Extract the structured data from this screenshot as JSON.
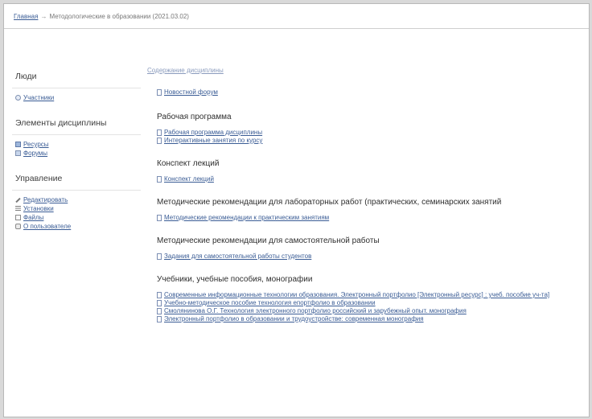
{
  "breadcrumb": {
    "home": "Главная",
    "separator": "→",
    "current": "Методологические в образовании (2021.03.02)"
  },
  "sidebar": {
    "blocks": [
      {
        "title": "Люди",
        "items": [
          {
            "label": "Участники",
            "icon": "people-icon"
          }
        ]
      },
      {
        "title": "Элементы дисциплины",
        "items": [
          {
            "label": "Ресурсы",
            "icon": "resources-icon"
          },
          {
            "label": "Форумы",
            "icon": "forums-icon"
          }
        ]
      },
      {
        "title": "Управление",
        "items": [
          {
            "label": "Редактировать",
            "icon": "edit-icon"
          },
          {
            "label": "Установки",
            "icon": "settings-icon"
          },
          {
            "label": "Файлы",
            "icon": "files-icon"
          },
          {
            "label": "О пользователе",
            "icon": "user-profile-icon"
          }
        ]
      }
    ]
  },
  "main": {
    "contents_label": "Содержание дисциплины",
    "first_link": "Новостной форум",
    "sections": [
      {
        "title": "Рабочая программа",
        "items": [
          "Рабочая программа дисциплины",
          "Интерактивные занятия по курсу"
        ]
      },
      {
        "title": "Конспект лекций",
        "items": [
          "Конспект лекций"
        ]
      },
      {
        "title": "Методические рекомендации для лабораторных работ (практических, семинарских занятий",
        "items": [
          "Методические рекомендации к практическим занятиям"
        ]
      },
      {
        "title": "Методические рекомендации для самостоятельной работы",
        "items": [
          "Задания для самостоятельной работы студентов"
        ]
      },
      {
        "title": "Учебники, учебные пособия, монографии",
        "items": [
          "Современные информационные технологии образования. Электронный портфолио [Электронный ресурс] : учеб. пособие уч-та]",
          "Учебно-методическое пособие технология епортфолио в образовании",
          "Смолянинова О.Г. Технология электронного портфолио российский и зарубежный опыт. монография",
          "Электронный портфолио в образовании и трудоустройстве: современная монография"
        ]
      }
    ]
  }
}
